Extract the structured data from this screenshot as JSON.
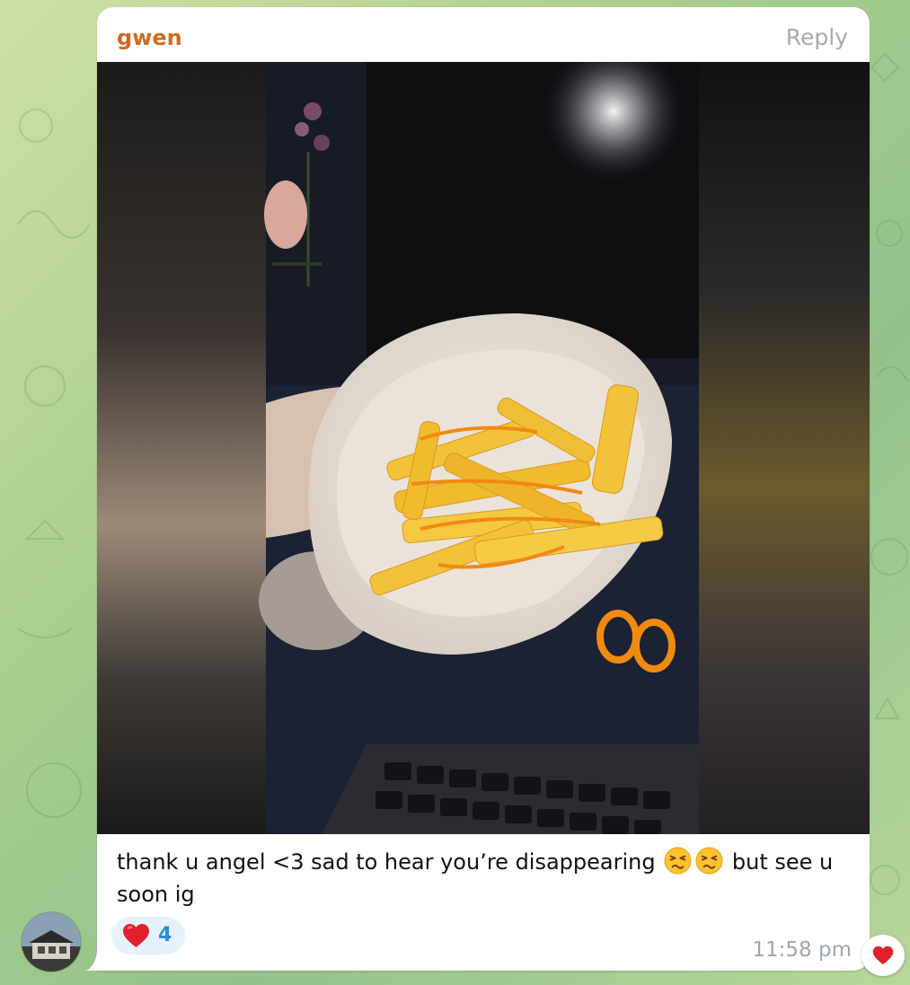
{
  "message": {
    "sender": "gwen",
    "reply_label": "Reply",
    "caption_part1": "thank u angel <3 sad to hear you’re disappearing",
    "caption_part2": "but see u soon ig",
    "emojis": [
      "persevering-face-icon",
      "persevering-face-icon"
    ],
    "time": "11:58 pm",
    "reaction": {
      "icon": "red-heart-icon",
      "count": "4"
    }
  },
  "quick_reaction": {
    "icon": "red-heart-icon"
  },
  "colors": {
    "sender": "#d2691e",
    "reply": "#a9a9a9",
    "reaction_bg": "#e5f1fb",
    "reaction_count": "#2b8dd6",
    "time": "#9ea7ae",
    "heart": "#e0202b"
  }
}
